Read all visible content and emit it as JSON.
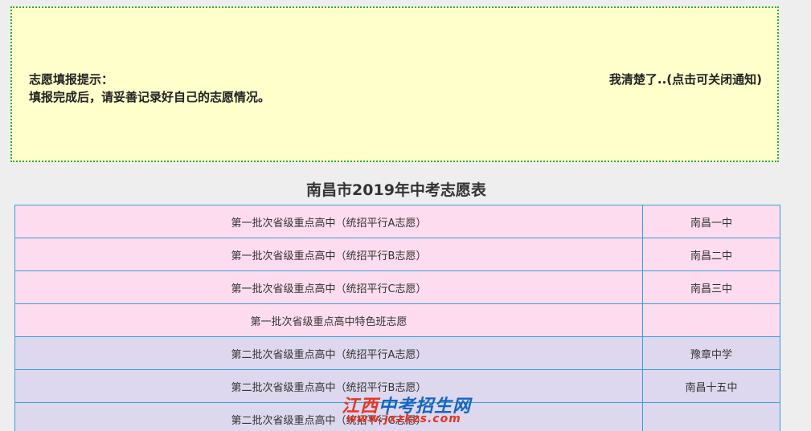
{
  "notice": {
    "title": "志愿填报提示：",
    "message": "填报完成后，请妥善记录好自己的志愿情况。",
    "close_label": "我清楚了..(点击可关闭通知)"
  },
  "table_title": "南昌市2019年中考志愿表",
  "rows": [
    {
      "name": "第一批次省级重点高中（统招平行A志愿）",
      "school": "南昌一中"
    },
    {
      "name": "第一批次省级重点高中（统招平行B志愿）",
      "school": "南昌二中"
    },
    {
      "name": "第一批次省级重点高中（统招平行C志愿）",
      "school": "南昌三中"
    },
    {
      "name": "第一批次省级重点高中特色班志愿",
      "school": ""
    },
    {
      "name": "第二批次省级重点高中（统招平行A志愿）",
      "school": "豫章中学"
    },
    {
      "name": "第二批次省级重点高中（统招平行B志愿）",
      "school": "南昌十五中"
    },
    {
      "name": "第二批次省级重点高中（统招平行C志愿）",
      "school": ""
    }
  ],
  "watermark": {
    "brand_part1": "江西",
    "brand_part2": "中考招生网",
    "url": "www.jxzkzs.com"
  },
  "colors": {
    "notice_bg": "#ffffcc",
    "notice_border": "#2eaa3a",
    "row_first_batch": "#fcdcee",
    "row_second_batch": "#ddd8ee",
    "table_border": "#3a9fd6"
  }
}
